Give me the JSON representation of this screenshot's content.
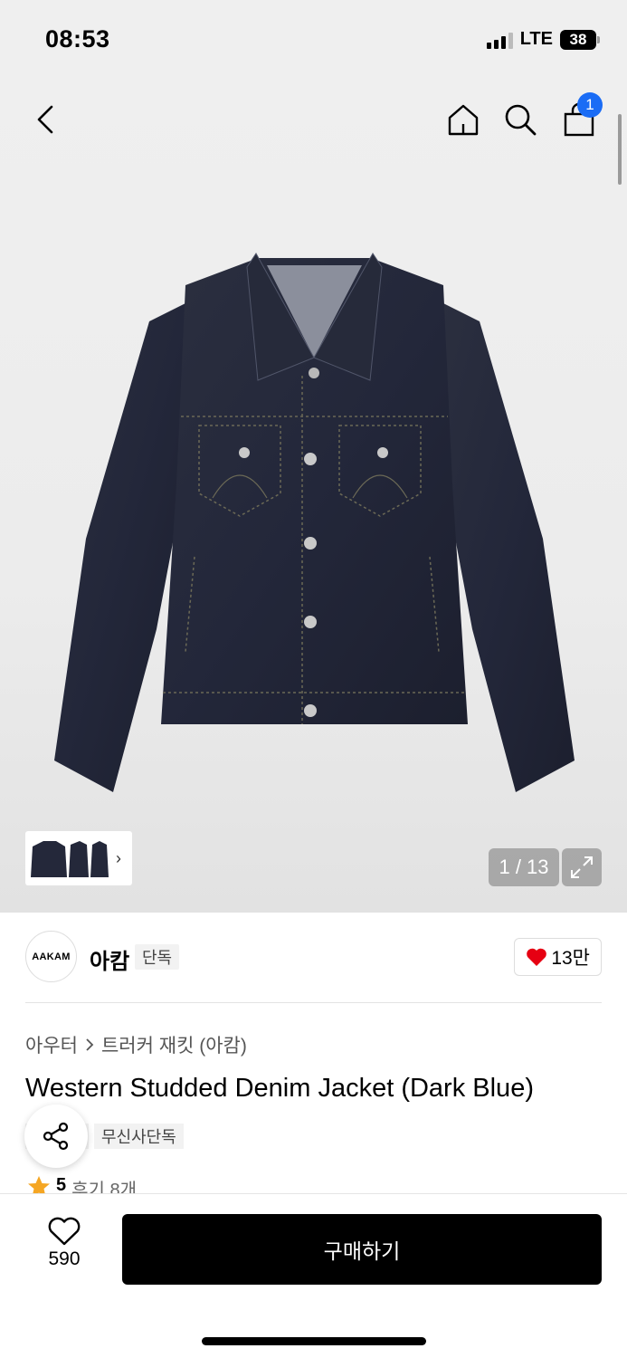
{
  "status_bar": {
    "time": "08:53",
    "network": "LTE",
    "battery": "38"
  },
  "nav": {
    "back_icon": "chevron-left-icon",
    "home_icon": "home-icon",
    "search_icon": "search-icon",
    "cart_icon": "shopping-bag-icon",
    "cart_count": "1"
  },
  "gallery": {
    "current_page": "1 / 13",
    "expand_icon": "expand-icon",
    "thumb_arrow": "›"
  },
  "brand": {
    "logo_text": "AAKAM",
    "name": "아캄",
    "tag": "단독",
    "likes": "13만"
  },
  "product": {
    "breadcrumb": [
      "아우터",
      "트러커 재킷 (아캄)"
    ],
    "title": "Western Studded Denim Jacket (Dark Blue)",
    "badges": [
      "",
      "무신사단독"
    ],
    "rating": "5",
    "reviews": "후기 8개"
  },
  "bottom": {
    "wish_count": "590",
    "buy_label": "구매하기"
  },
  "colors": {
    "accent": "#1a6cf5",
    "heart": "#e60012",
    "star": "#f5a623",
    "buy_button": "#000000"
  }
}
